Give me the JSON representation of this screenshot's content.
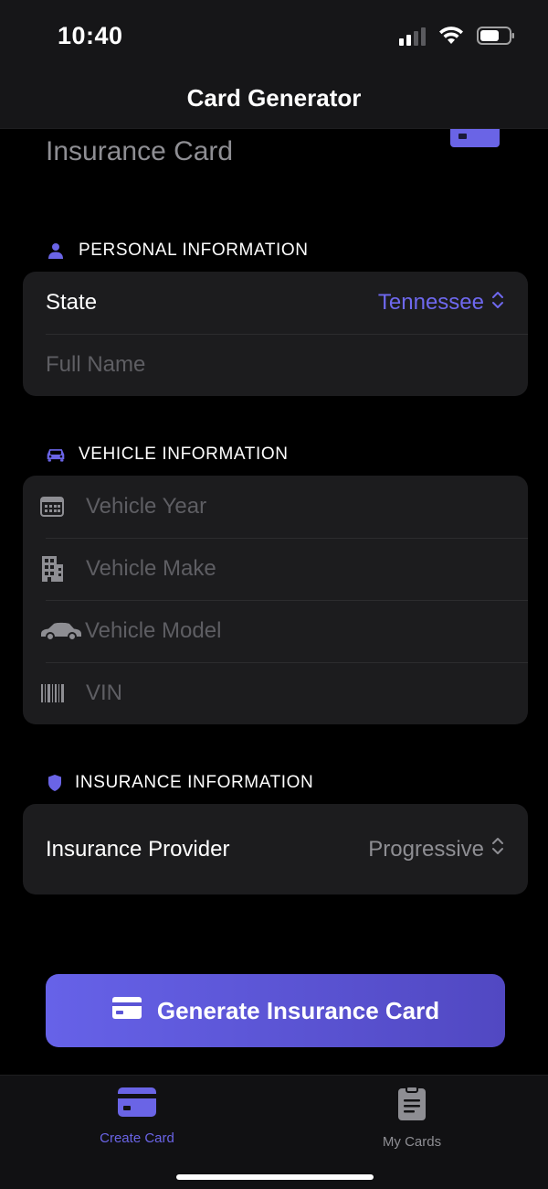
{
  "status_bar": {
    "time": "10:40"
  },
  "nav": {
    "title": "Card Generator"
  },
  "page": {
    "heading": "Insurance Card"
  },
  "sections": {
    "personal": {
      "label": "PERSONAL INFORMATION",
      "icon": "person-icon"
    },
    "vehicle": {
      "label": "VEHICLE INFORMATION",
      "icon": "car-icon"
    },
    "insurance": {
      "label": "INSURANCE INFORMATION",
      "icon": "shield-icon"
    }
  },
  "personal": {
    "state_label": "State",
    "state_value": "Tennessee",
    "full_name_placeholder": "Full Name"
  },
  "vehicle": {
    "year_placeholder": "Vehicle Year",
    "make_placeholder": "Vehicle Make",
    "model_placeholder": "Vehicle Model",
    "vin_placeholder": "VIN"
  },
  "insurance": {
    "provider_label": "Insurance Provider",
    "provider_value": "Progressive"
  },
  "generate_button": {
    "label": "Generate Insurance Card"
  },
  "tabs": [
    {
      "label": "Create Card",
      "icon": "credit-card-icon",
      "active": true
    },
    {
      "label": "My Cards",
      "icon": "document-icon",
      "active": false
    }
  ],
  "colors": {
    "accent": "#6a64e6",
    "background": "#000000",
    "group_background": "#1c1c1e",
    "muted_text": "#8e8e93"
  }
}
